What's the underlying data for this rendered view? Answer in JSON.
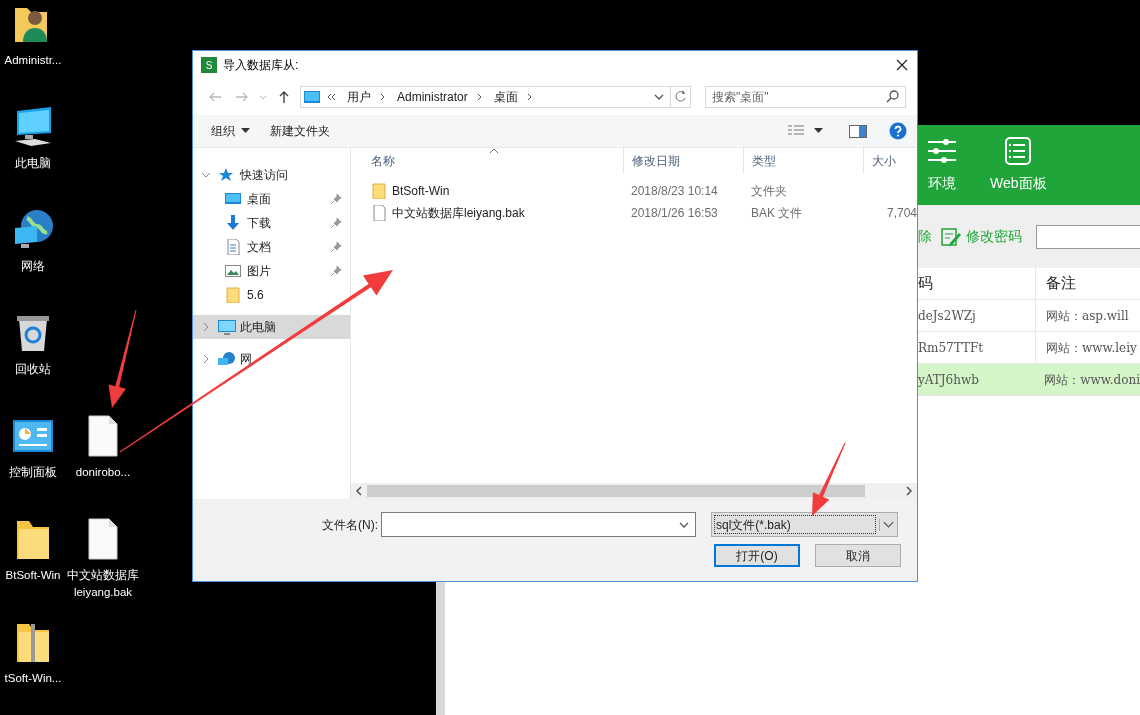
{
  "desktop": {
    "icons": [
      {
        "label": "Administr...",
        "kind": "user"
      },
      {
        "label": "此电脑",
        "kind": "computer"
      },
      {
        "label": "网络",
        "kind": "network"
      },
      {
        "label": "回收站",
        "kind": "recycle"
      },
      {
        "label": "控制面板",
        "kind": "panel"
      },
      {
        "label": "donirobo...",
        "kind": "file"
      },
      {
        "label": "BtSoft-Win",
        "kind": "folder"
      },
      {
        "label": "中文站数据库 leiyang.bak",
        "kind": "file"
      },
      {
        "label": "tSoft-Win...",
        "kind": "zip"
      }
    ]
  },
  "background_app": {
    "header_items": [
      {
        "label": "环境",
        "kind": "sliders"
      },
      {
        "label": "Web面板",
        "kind": "list"
      }
    ],
    "actions": [
      {
        "label": "除"
      },
      {
        "label": "修改密码",
        "kind": "edit"
      }
    ],
    "table": {
      "columns": [
        "码",
        "备注"
      ],
      "rows": [
        {
          "cells": [
            "deJs2WZj",
            "网站：asp.will"
          ],
          "selected": false
        },
        {
          "cells": [
            "Rm57TTFt",
            "网站：www.leiy"
          ],
          "selected": false
        },
        {
          "cells": [
            "yATJ6hwb",
            "网站：www.doni"
          ],
          "selected": true
        }
      ]
    }
  },
  "dialog": {
    "icon_text": "S",
    "title": "导入数据库从:",
    "address": [
      "用户",
      "Administrator",
      "桌面"
    ],
    "search_placeholder": "搜索\"桌面\"",
    "toolbar": [
      {
        "label": "组织",
        "kind": "menu"
      },
      {
        "label": "新建文件夹",
        "kind": "plain"
      }
    ],
    "nav": [
      {
        "label": "快速访问",
        "kind": "star",
        "expanded": true,
        "selected": false,
        "children": [
          {
            "label": "桌面",
            "kind": "desktop",
            "pinned": true
          },
          {
            "label": "下载",
            "kind": "download",
            "pinned": true
          },
          {
            "label": "文档",
            "kind": "document",
            "pinned": true
          },
          {
            "label": "图片",
            "kind": "image",
            "pinned": true
          },
          {
            "label": "5.6",
            "kind": "folder",
            "pinned": false
          }
        ]
      },
      {
        "label": "此电脑",
        "kind": "computer",
        "expanded": false,
        "selected": true
      },
      {
        "label": "网",
        "kind": "network",
        "expanded": false,
        "selected": false
      }
    ],
    "columns": [
      "名称",
      "修改日期",
      "类型",
      "大小"
    ],
    "files": [
      {
        "kind": "folder",
        "cells": [
          "BtSoft-Win",
          "2018/8/23 10:14",
          "文件夹",
          ""
        ]
      },
      {
        "kind": "file",
        "cells": [
          "中文站数据库leiyang.bak",
          "2018/1/26 16:53",
          "BAK 文件",
          "7,704"
        ]
      }
    ],
    "filename_label": "文件名(N):",
    "filter": "sql文件(*.bak)",
    "buttons": [
      {
        "label": "打开(O)",
        "default": true
      },
      {
        "label": "取消",
        "default": false
      }
    ]
  }
}
